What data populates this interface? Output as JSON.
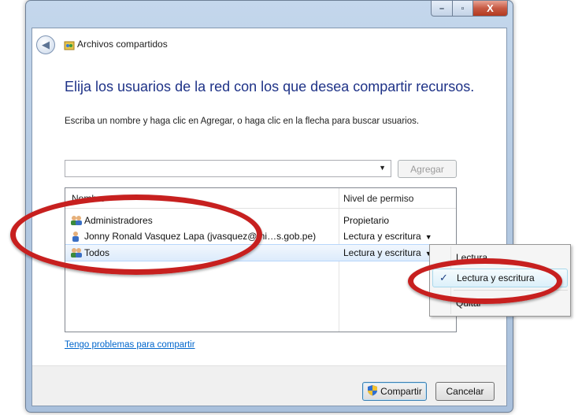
{
  "window": {
    "title": "Archivos compartidos",
    "caption_min": "–",
    "caption_max": "▫",
    "caption_close": "X"
  },
  "heading": "Elija los usuarios de la red con los que desea compartir recursos.",
  "instruction": "Escriba un nombre y haga clic en Agregar, o haga clic en la flecha para buscar usuarios.",
  "name_input": {
    "value": "",
    "placeholder": ""
  },
  "add_button": "Agregar",
  "table": {
    "columns": [
      "Nombre",
      "Nivel de permiso"
    ],
    "rows": [
      {
        "name": "Administradores",
        "permission": "Propietario",
        "icon": "users-group-icon",
        "has_dropdown": false
      },
      {
        "name": "Jonny Ronald Vasquez Lapa (jvasquez@mi…s.gob.pe)",
        "permission": "Lectura y escritura",
        "icon": "user-icon",
        "has_dropdown": true
      },
      {
        "name": "Todos",
        "permission": "Lectura y escritura",
        "icon": "users-group-icon",
        "has_dropdown": true,
        "selected": true
      }
    ]
  },
  "permission_menu": {
    "items": [
      "Lectura",
      "Lectura y escritura",
      "Quitar"
    ],
    "checked": "Lectura y escritura"
  },
  "help_link": "Tengo problemas para compartir",
  "footer": {
    "share_label": "Compartir",
    "cancel_label": "Cancelar"
  },
  "colors": {
    "heading": "#1e3287",
    "link": "#0066cc",
    "annotation": "#c7201f"
  }
}
